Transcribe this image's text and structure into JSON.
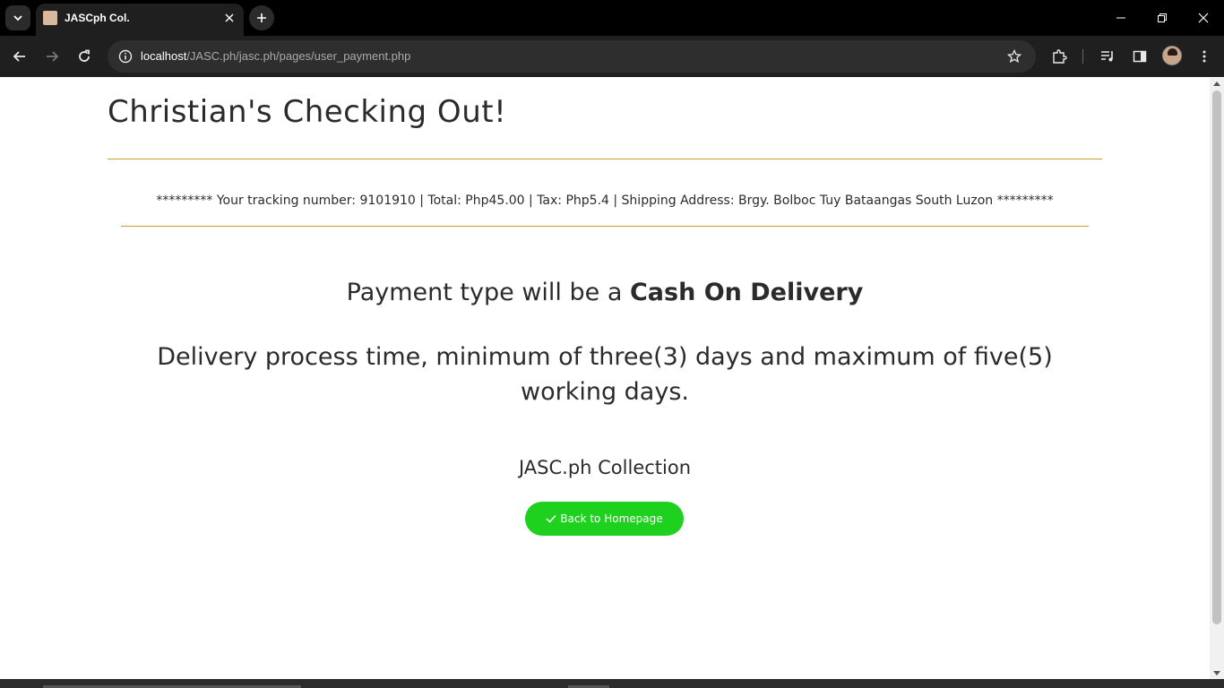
{
  "browser": {
    "tab": {
      "title": "JASCph Col."
    },
    "address": {
      "host": "localhost",
      "path": "/JASC.ph/jasc.ph/pages/user_payment.php"
    },
    "icons": {
      "tab_search": "chevron-down-icon",
      "tab_close": "close-icon",
      "new_tab": "plus-icon",
      "minimize": "minimize-icon",
      "restore": "restore-icon",
      "close_window": "close-icon",
      "back": "arrow-left-icon",
      "forward": "arrow-right-icon",
      "reload": "reload-icon",
      "site_info": "info-icon",
      "bookmark": "star-icon",
      "extensions": "puzzle-icon",
      "media": "media-queue-icon",
      "side_panel": "side-panel-icon",
      "menu": "kebab-menu-icon"
    }
  },
  "page": {
    "heading": "Christian's Checking Out!",
    "tracking_line": "********* Your tracking number: 9101910 | Total: Php45.00 | Tax: Php5.4 | Shipping Address: Brgy. Bolboc Tuy Bataangas South Luzon *********",
    "payment_prefix": "Payment type will be a ",
    "payment_type": "Cash On Delivery",
    "delivery_note": "Delivery process time, minimum of three(3) days and maximum of five(5) working days.",
    "brand": "JASC.ph Collection",
    "back_button": "Back to Homepage"
  },
  "colors": {
    "accent_button": "#1ed11e",
    "rule": "#c8a030",
    "chrome_dark": "#1f1f1f"
  }
}
